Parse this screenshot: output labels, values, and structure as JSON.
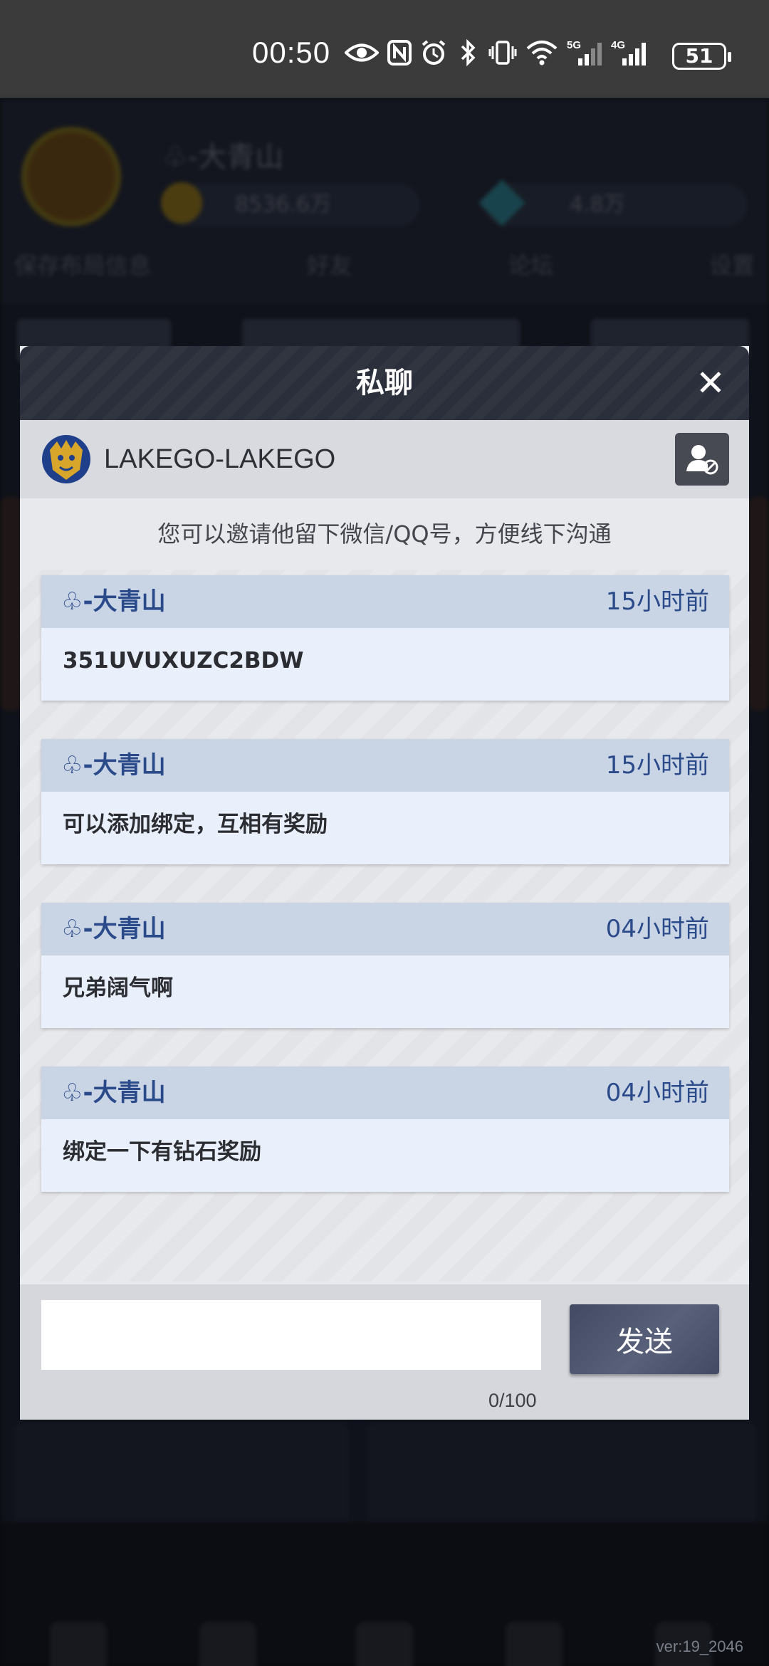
{
  "status_bar": {
    "time": "00:50",
    "battery": "51",
    "icons": [
      "eye-icon",
      "nfc-icon",
      "alarm-icon",
      "bluetooth-icon",
      "vibrate-icon",
      "wifi-icon",
      "5g-signal-icon",
      "4g-signal-icon"
    ],
    "network_5g": "5G",
    "network_4g": "4G"
  },
  "background": {
    "player_name": "♧-大青山",
    "coins": "8536.6万",
    "gems": "4.8万",
    "menu": [
      "保存布局信息",
      "好友",
      "论坛",
      "设置"
    ],
    "version": "ver:19_2046"
  },
  "dialog": {
    "title": "私聊",
    "close_glyph": "✕",
    "chat_user": "LAKEGO-LAKEGO",
    "hint": "您可以邀请他留下微信/QQ号，方便线下沟通",
    "messages": [
      {
        "sender": "♧-大青山",
        "time": "15小时前",
        "text": "351UVUXUZC2BDW"
      },
      {
        "sender": "♧-大青山",
        "time": "15小时前",
        "text": "可以添加绑定，互相有奖励"
      },
      {
        "sender": "♧-大青山",
        "time": "04小时前",
        "text": "兄弟阔气啊"
      },
      {
        "sender": "♧-大青山",
        "time": "04小时前",
        "text": "绑定一下有钻石奖励"
      }
    ],
    "input": {
      "value": "",
      "placeholder": ""
    },
    "send_label": "发送",
    "char_counter": "0/100"
  },
  "colors": {
    "header_bg": "#2a2f3b",
    "msg_head_bg": "#c9d4e5",
    "msg_body_bg": "#eaf0fb",
    "accent_text": "#2a4a8a",
    "send_button": "#4a5069"
  }
}
